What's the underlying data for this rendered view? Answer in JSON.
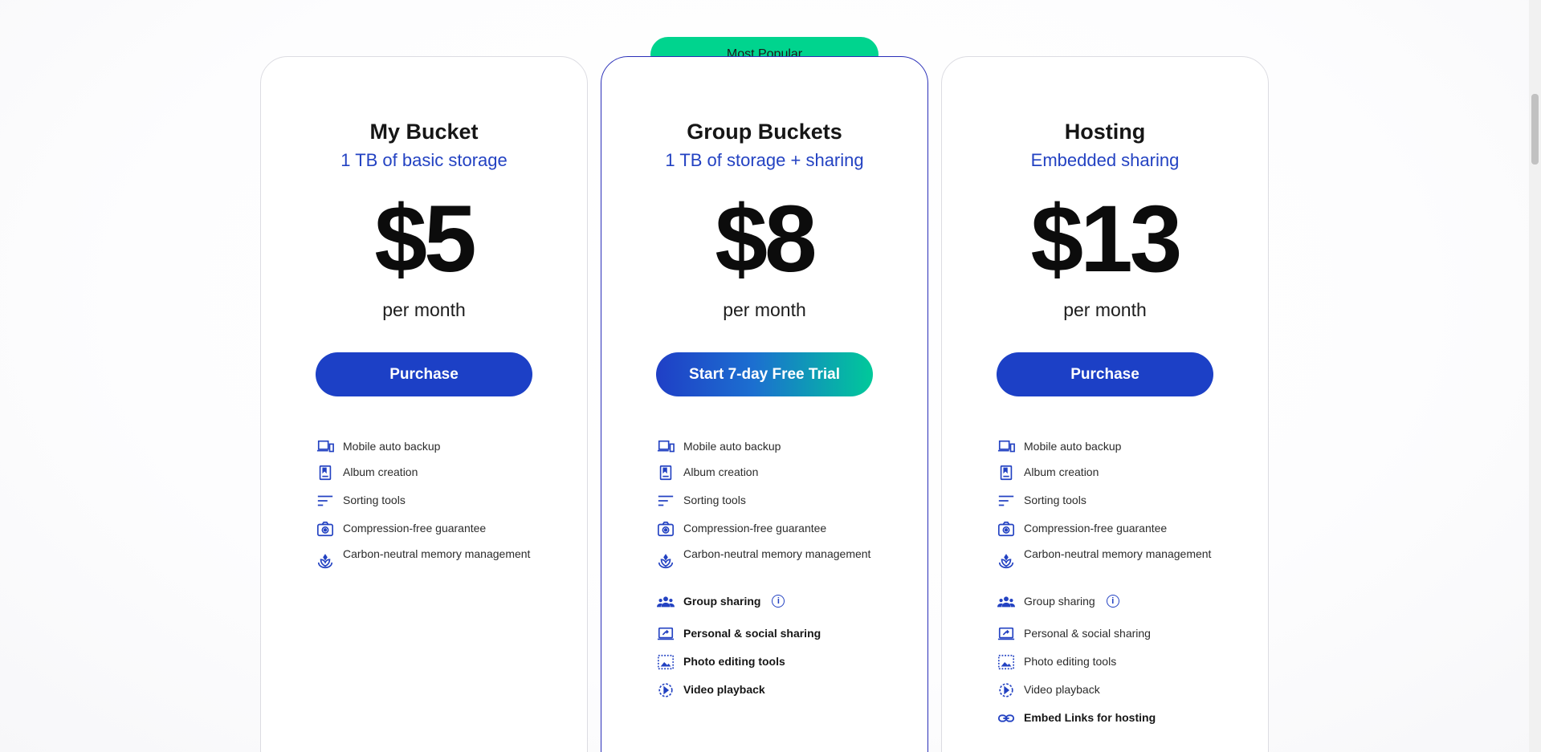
{
  "badge": "Most Popular",
  "plans": [
    {
      "title": "My Bucket",
      "subtitle": "1 TB of basic storage",
      "price": "$5",
      "period": "per month",
      "cta": "Purchase",
      "features": [
        {
          "label": "Mobile auto backup",
          "icon": "devices-icon"
        },
        {
          "label": "Album creation",
          "icon": "album-icon"
        },
        {
          "label": "Sorting tools",
          "icon": "sort-icon"
        },
        {
          "label": "Compression-free guarantee",
          "icon": "camera-icon"
        },
        {
          "label": "Carbon-neutral memory management",
          "icon": "leaf-icon"
        }
      ]
    },
    {
      "title": "Group Buckets",
      "subtitle": "1 TB of storage + sharing",
      "price": "$8",
      "period": "per month",
      "cta": "Start 7-day Free Trial",
      "features": [
        {
          "label": "Mobile auto backup",
          "icon": "devices-icon"
        },
        {
          "label": "Album creation",
          "icon": "album-icon"
        },
        {
          "label": "Sorting tools",
          "icon": "sort-icon"
        },
        {
          "label": "Compression-free guarantee",
          "icon": "camera-icon"
        },
        {
          "label": "Carbon-neutral memory management",
          "icon": "leaf-icon"
        },
        {
          "label": "Group sharing",
          "icon": "group-icon"
        },
        {
          "label": "Personal & social sharing",
          "icon": "share-screen-icon"
        },
        {
          "label": "Photo editing tools",
          "icon": "photo-edit-icon"
        },
        {
          "label": "Video playback",
          "icon": "play-icon"
        }
      ]
    },
    {
      "title": "Hosting",
      "subtitle": "Embedded sharing",
      "price": "$13",
      "period": "per month",
      "cta": "Purchase",
      "features": [
        {
          "label": "Mobile auto backup",
          "icon": "devices-icon"
        },
        {
          "label": "Album creation",
          "icon": "album-icon"
        },
        {
          "label": "Sorting tools",
          "icon": "sort-icon"
        },
        {
          "label": "Compression-free guarantee",
          "icon": "camera-icon"
        },
        {
          "label": "Carbon-neutral memory management",
          "icon": "leaf-icon"
        },
        {
          "label": "Group sharing",
          "icon": "group-icon"
        },
        {
          "label": "Personal & social sharing",
          "icon": "share-screen-icon"
        },
        {
          "label": "Photo editing tools",
          "icon": "photo-edit-icon"
        },
        {
          "label": "Video playback",
          "icon": "play-icon"
        },
        {
          "label": "Embed Links for hosting",
          "icon": "link-icon"
        }
      ]
    }
  ],
  "colors": {
    "accent": "#1c40c6",
    "badge": "#00d48e",
    "subtitle": "#2342c2"
  }
}
